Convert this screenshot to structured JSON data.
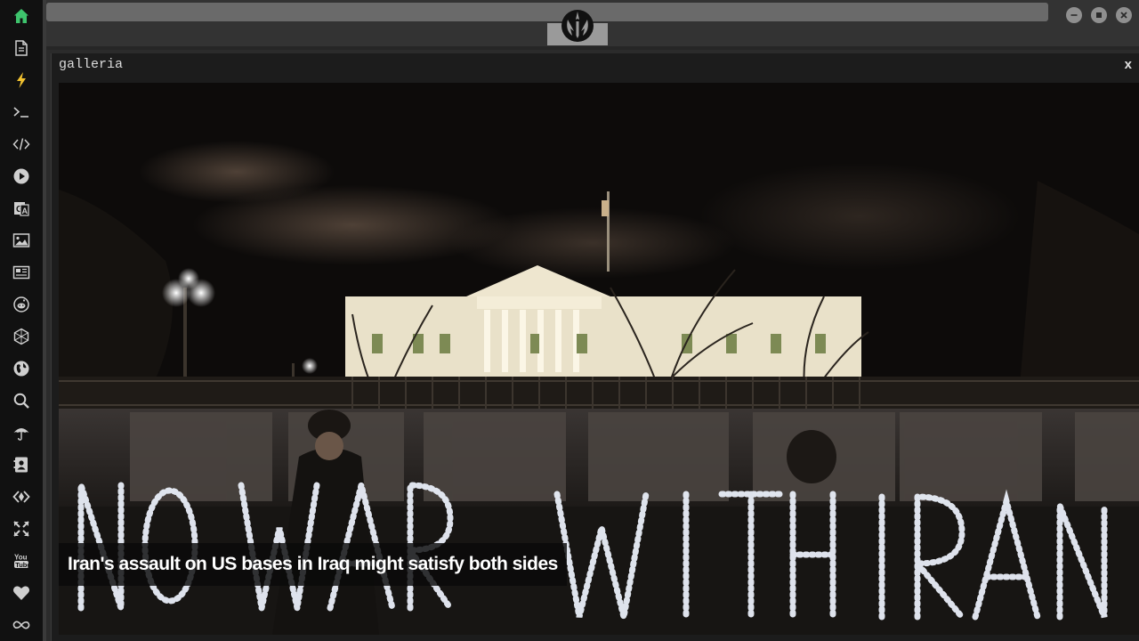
{
  "window": {
    "panel_title": "galleria",
    "close_label": "x"
  },
  "dock": {
    "items": [
      {
        "icon": "home-icon"
      },
      {
        "icon": "document-icon"
      },
      {
        "icon": "lightning-icon"
      },
      {
        "icon": "terminal-icon"
      },
      {
        "icon": "code-icon"
      },
      {
        "icon": "play-icon"
      },
      {
        "icon": "translate-icon"
      },
      {
        "icon": "image-icon"
      },
      {
        "icon": "newspaper-icon"
      },
      {
        "icon": "reddit-icon"
      },
      {
        "icon": "hexagon-icon"
      },
      {
        "icon": "globe-icon"
      },
      {
        "icon": "search-icon"
      },
      {
        "icon": "umbrella-icon"
      },
      {
        "icon": "contact-card-icon"
      },
      {
        "icon": "code-tag-icon"
      },
      {
        "icon": "expand-icon"
      },
      {
        "icon": "youtube-icon"
      },
      {
        "icon": "heart-icon"
      },
      {
        "icon": "infinity-icon"
      }
    ]
  },
  "gallery": {
    "caption": "Iran's assault on US bases in Iraq might satisfy both sides",
    "sign_text": "NO WAR WITH IRAN"
  },
  "colors": {
    "home_accent": "#3ec46d",
    "lightning_accent": "#f2c230",
    "dock_bg": "#111111",
    "panel_bg": "#1c1c1c"
  }
}
